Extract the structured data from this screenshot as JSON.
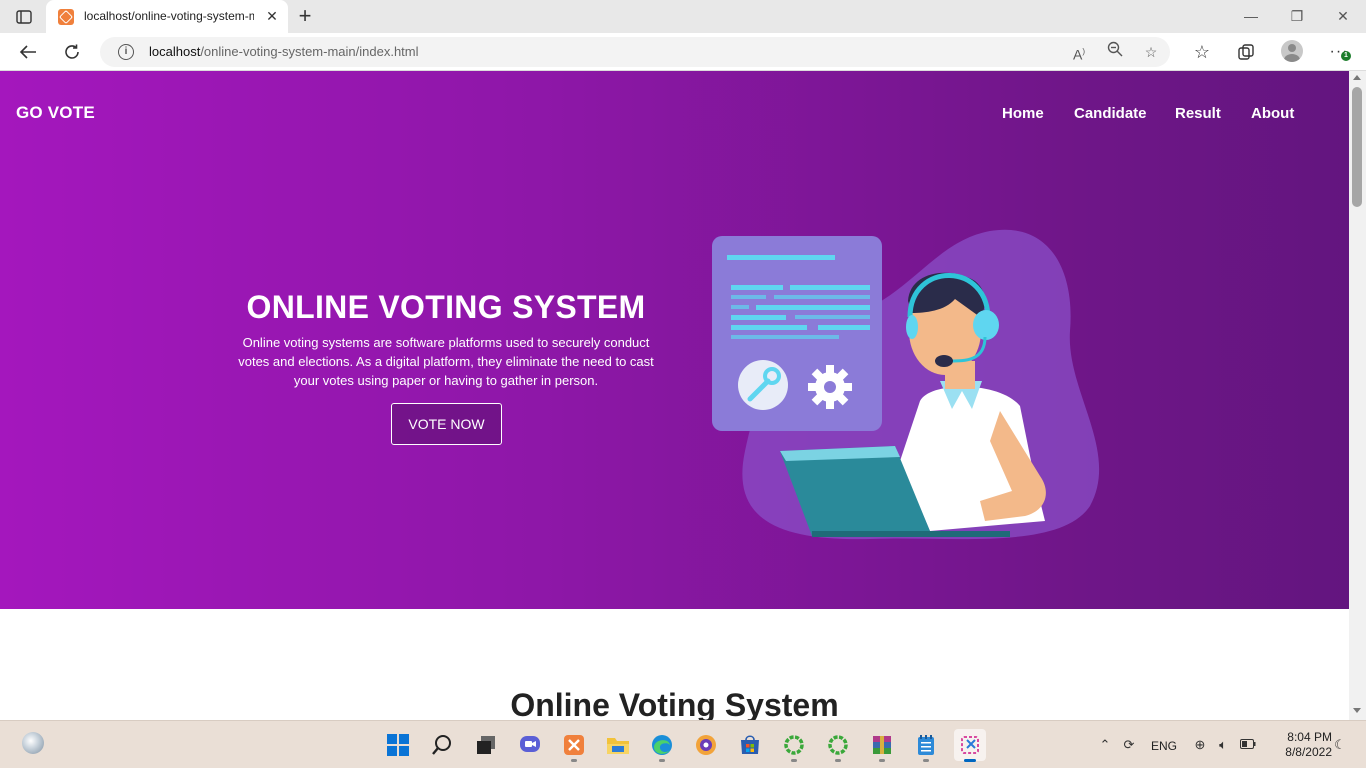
{
  "browser": {
    "tab_title": "localhost/online-voting-system-main/index.html",
    "url_host": "localhost",
    "url_path": "/online-voting-system-main/index.html",
    "notification_badge": "1"
  },
  "site": {
    "brand": "GO VOTE",
    "nav": [
      "Home",
      "Candidate",
      "Result",
      "About"
    ],
    "hero_title": "ONLINE VOTING SYSTEM",
    "hero_description": "Online voting systems are software platforms used to securely conduct votes and elections. As a digital platform, they eliminate the need to cast your votes using paper or having to gather in person.",
    "cta_label": "VOTE NOW",
    "section_title": "Online Voting System",
    "colors": {
      "hero_start": "#a417bd",
      "hero_end": "#63157f",
      "accent_cyan": "#5fd6f0"
    }
  },
  "taskbar": {
    "language": "ENG",
    "time": "8:04 PM",
    "date": "8/8/2022"
  }
}
